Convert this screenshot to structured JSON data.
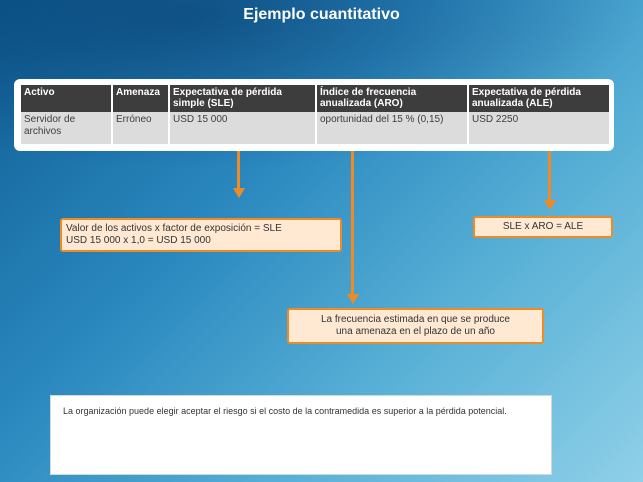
{
  "title": "Ejemplo cuantitativo",
  "table": {
    "headers": [
      "Activo",
      "Amenaza",
      "Expectativa de pérdida simple (SLE)",
      "Índice de frecuencia anualizada (ARO)",
      "Expectativa de pérdida anualizada (ALE)"
    ],
    "rows": [
      [
        "Servidor de archivos",
        "Erróneo",
        "USD 15 000",
        "oportunidad del 15 % (0,15)",
        "USD 2250"
      ]
    ]
  },
  "callouts": {
    "sle_formula": {
      "line1": "Valor de los activos x factor de exposición = SLE",
      "line2": "USD 15 000 x 1,0 = USD 15 000"
    },
    "ale_formula": "SLE x ARO = ALE",
    "aro_definition": {
      "line1": "La frecuencia estimada en que se produce",
      "line2": "una amenaza en el plazo de un año"
    }
  },
  "note": "La organización puede elegir aceptar el riesgo si el costo de la contramedida es superior a la pérdida potencial.",
  "colors": {
    "accent": "#f08a24",
    "callout_fill": "#ffe9d3",
    "header": "#3d3d3d",
    "cell": "#dcdcdc"
  }
}
